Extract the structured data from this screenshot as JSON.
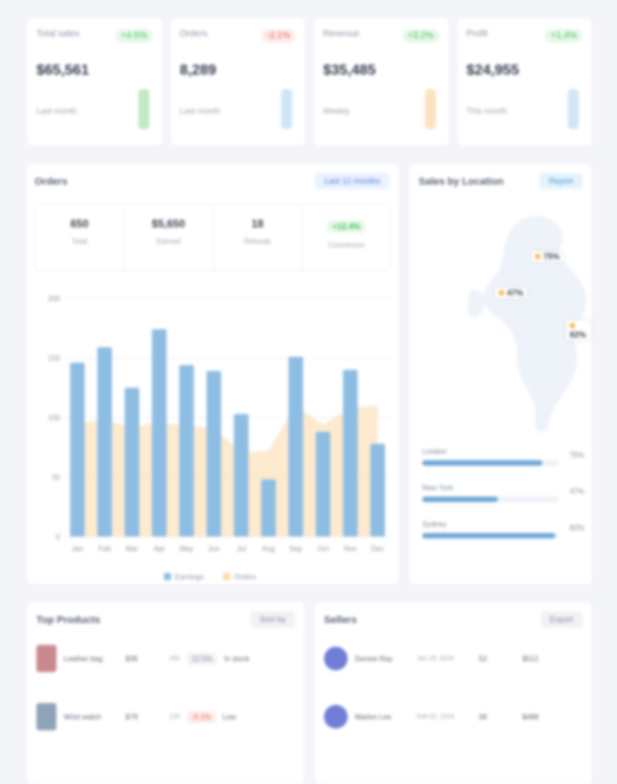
{
  "kpis": [
    {
      "label": "Total sales",
      "pct": "+4.5%",
      "trend": "up",
      "value": "$65,561",
      "sub": "Last month",
      "spark_color": "#bfeac6"
    },
    {
      "label": "Orders",
      "pct": "-2.1%",
      "trend": "down",
      "value": "8,289",
      "sub": "Last month",
      "spark_color": "#cfe6f7"
    },
    {
      "label": "Revenue",
      "pct": "+3.2%",
      "trend": "up",
      "value": "$35,485",
      "sub": "Weekly",
      "spark_color": "#fde1c1"
    },
    {
      "label": "Profit",
      "pct": "+1.4%",
      "trend": "up",
      "value": "$24,955",
      "sub": "This month",
      "spark_color": "#cfe6f7"
    }
  ],
  "orders": {
    "title": "Orders",
    "filter": "Last 12 months",
    "stats": [
      {
        "value": "650",
        "label": "Total"
      },
      {
        "value": "$5,650",
        "label": "Earned"
      },
      {
        "value": "18",
        "label": "Refunds"
      },
      {
        "value": "+12.4%",
        "label": "Conversion",
        "is_change": true
      }
    ],
    "legend": [
      "Earnings",
      "Orders"
    ]
  },
  "chart_data": {
    "type": "bar",
    "categories": [
      "Jan",
      "Feb",
      "Mar",
      "Apr",
      "May",
      "Jun",
      "Jul",
      "Aug",
      "Sep",
      "Oct",
      "Nov",
      "Dec"
    ],
    "yticks": [
      "200",
      "150",
      "100",
      "50",
      "0"
    ],
    "ylim": [
      0,
      200
    ],
    "series": [
      {
        "name": "Earnings",
        "type": "bar",
        "color": "#8ebde3",
        "values": [
          146,
          159,
          125,
          174,
          144,
          139,
          103,
          48,
          151,
          88,
          140,
          78
        ]
      },
      {
        "name": "Orders",
        "type": "area",
        "color": "#fbd9a8",
        "values": [
          95,
          98,
          92,
          96,
          93,
          91,
          71,
          72,
          110,
          94,
          108,
          110
        ]
      }
    ]
  },
  "locations": {
    "title": "Sales by Location",
    "filter": "Report",
    "markers": [
      {
        "label": "75%"
      },
      {
        "label": "47%"
      },
      {
        "label": "82%"
      }
    ],
    "bars": [
      {
        "name": "London",
        "value": "75%",
        "pct": 0.88
      },
      {
        "name": "New York",
        "value": "47%",
        "pct": 0.55
      },
      {
        "name": "Sydney",
        "value": "82%",
        "pct": 0.97
      }
    ]
  },
  "bottom_left": {
    "title": "Top Products",
    "filter": "Sort by",
    "rows": [
      {
        "name": "Leather bag",
        "col1": "$36",
        "col2": "250",
        "col3": "12.5%",
        "tag": "In stock"
      },
      {
        "name": "Wrist watch",
        "col1": "$79",
        "col2": "120",
        "col3": "-5.1%",
        "tag": "Low"
      }
    ]
  },
  "bottom_right": {
    "title": "Sellers",
    "filter": "Export",
    "rows": [
      {
        "name": "Denise Ray",
        "meta": "Jan 25, 2024",
        "qty": "52",
        "total": "$512"
      },
      {
        "name": "Marlon Lee",
        "meta": "Feb 02, 2024",
        "qty": "38",
        "total": "$488"
      }
    ]
  }
}
